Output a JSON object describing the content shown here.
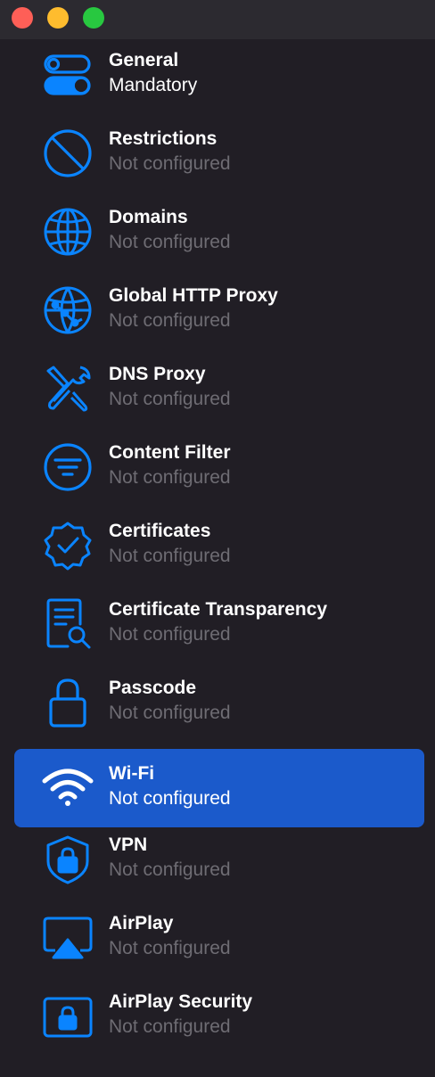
{
  "window": {
    "traffic_lights": {
      "close_color": "#fe5f57",
      "minimize_color": "#febc2e",
      "maximize_color": "#28c840"
    }
  },
  "colors": {
    "accent": "#0a84ff",
    "selected_background": "#1b5acb",
    "muted_text": "#6e6c73"
  },
  "items": [
    {
      "label": "General",
      "status": "Mandatory",
      "icon": "toggle-switches-icon",
      "selected": false
    },
    {
      "label": "Restrictions",
      "status": "Not configured",
      "icon": "prohibited-icon",
      "selected": false
    },
    {
      "label": "Domains",
      "status": "Not configured",
      "icon": "globe-icon",
      "selected": false
    },
    {
      "label": "Global HTTP Proxy",
      "status": "Not configured",
      "icon": "globe-network-icon",
      "selected": false
    },
    {
      "label": "DNS Proxy",
      "status": "Not configured",
      "icon": "tools-icon",
      "selected": false
    },
    {
      "label": "Content Filter",
      "status": "Not configured",
      "icon": "filter-circle-icon",
      "selected": false
    },
    {
      "label": "Certificates",
      "status": "Not configured",
      "icon": "checkmark-seal-icon",
      "selected": false
    },
    {
      "label": "Certificate Transparency",
      "status": "Not configured",
      "icon": "document-magnifier-icon",
      "selected": false
    },
    {
      "label": "Passcode",
      "status": "Not configured",
      "icon": "lock-icon",
      "selected": false
    },
    {
      "label": "Wi-Fi",
      "status": "Not configured",
      "icon": "wifi-icon",
      "selected": true
    },
    {
      "label": "VPN",
      "status": "Not configured",
      "icon": "lock-shield-icon",
      "selected": false
    },
    {
      "label": "AirPlay",
      "status": "Not configured",
      "icon": "airplay-icon",
      "selected": false
    },
    {
      "label": "AirPlay Security",
      "status": "Not configured",
      "icon": "airplay-lock-icon",
      "selected": false
    }
  ]
}
